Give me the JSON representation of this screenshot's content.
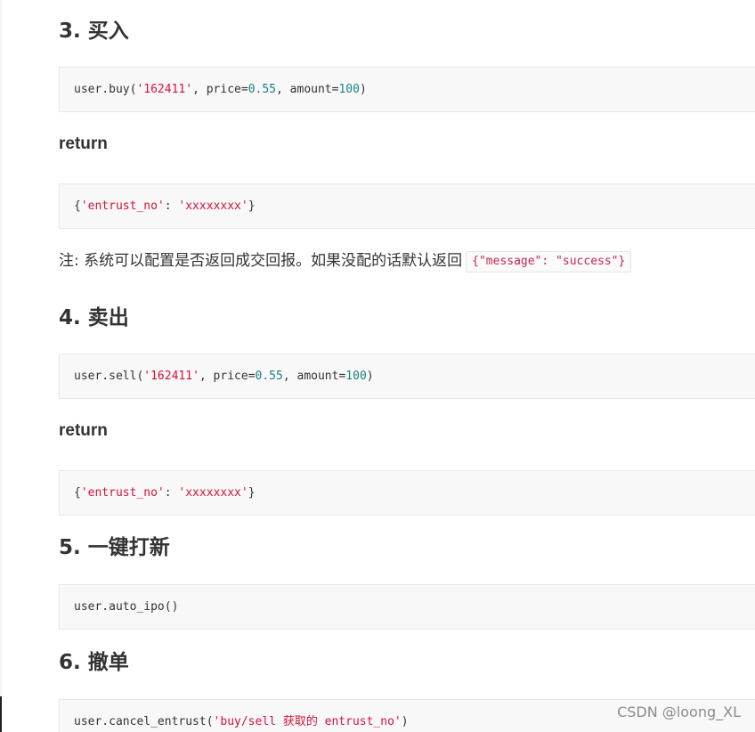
{
  "sections": {
    "buy": {
      "heading": "3. 买入",
      "code": {
        "prefix": "user.buy(",
        "arg1": "'162411'",
        "mid1": ", price=",
        "price": "0.55",
        "mid2": ", amount=",
        "amount": "100",
        "suffix": ")"
      },
      "return_label": "return",
      "return_code": {
        "open": "{",
        "key": "'entrust_no'",
        "colon": ": ",
        "value": "'xxxxxxxx'",
        "close": "}"
      },
      "note_text": "注: 系统可以配置是否返回成交回报。如果没配的话默认返回",
      "note_code": "{\"message\": \"success\"}"
    },
    "sell": {
      "heading": "4. 卖出",
      "code": {
        "prefix": "user.sell(",
        "arg1": "'162411'",
        "mid1": ", price=",
        "price": "0.55",
        "mid2": ", amount=",
        "amount": "100",
        "suffix": ")"
      },
      "return_label": "return",
      "return_code": {
        "open": "{",
        "key": "'entrust_no'",
        "colon": ": ",
        "value": "'xxxxxxxx'",
        "close": "}"
      }
    },
    "ipo": {
      "heading": "5. 一键打新",
      "code": "user.auto_ipo()"
    },
    "cancel": {
      "heading": "6. 撤单",
      "code": {
        "prefix": "user.cancel_entrust(",
        "arg": "'buy/sell 获取的 entrust_no'",
        "suffix": ")"
      }
    }
  },
  "watermark": "CSDN @loong_XL",
  "colors": {
    "string": "#d0143a",
    "number": "#1a7f7f",
    "code_bg": "#f8f8f8",
    "text": "#333333"
  }
}
